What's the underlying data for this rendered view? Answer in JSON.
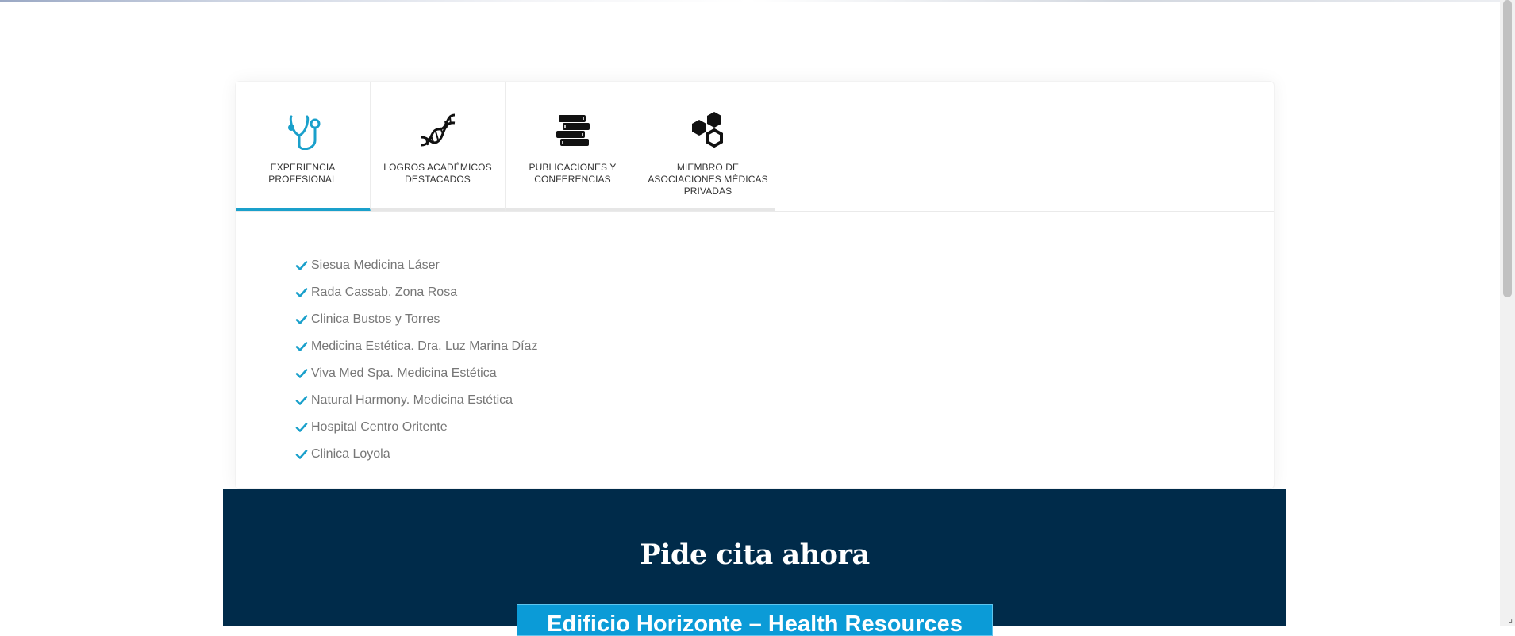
{
  "tabs": [
    {
      "label": "Experiencia profesional",
      "icon": "stethoscope-icon",
      "active": true
    },
    {
      "label": "Logros académicos destacados",
      "icon": "dna-icon",
      "active": false
    },
    {
      "label": "Publicaciones y conferencias",
      "icon": "books-icon",
      "active": false
    },
    {
      "label": "Miembro de asociaciones médicas privadas",
      "icon": "hexagons-icon",
      "active": false
    }
  ],
  "experience_list": [
    "Siesua Medicina Láser",
    "Rada Cassab. Zona Rosa",
    "Clinica Bustos y Torres",
    "Medicina Estética. Dra. Luz Marina Díaz",
    "Viva Med Spa. Medicina Estética",
    "Natural Harmony. Medicina Estética",
    "Hospital Centro Oritente",
    "Clinica Loyola"
  ],
  "cta": {
    "title": "Pide cita ahora",
    "button_label": "Edificio Horizonte – Health Resources"
  },
  "colors": {
    "accent": "#1aa0cb",
    "cta_background": "#002b4a",
    "button": "#0b9bd7",
    "list_text": "#777777"
  }
}
